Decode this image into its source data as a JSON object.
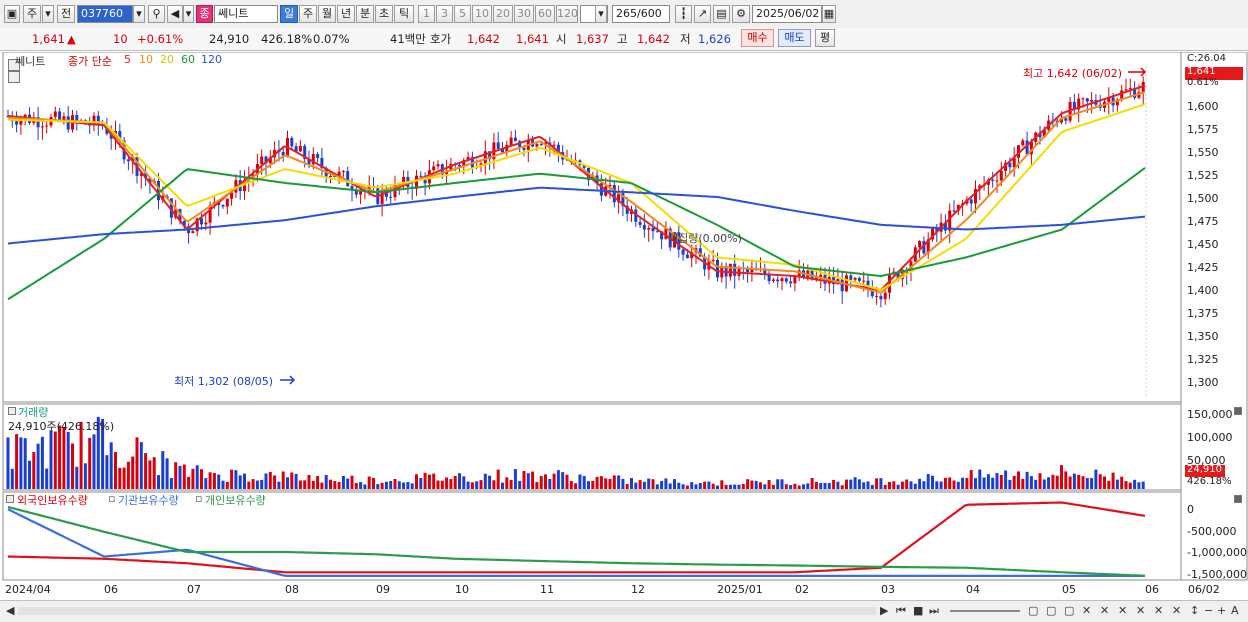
{
  "toolbar": {
    "mode_label": "주",
    "prev_label": "전",
    "code_value": "037760",
    "badge_label": "종",
    "stock_name": "쎄니트",
    "periods": [
      "일",
      "주",
      "월",
      "년",
      "분",
      "초",
      "틱"
    ],
    "active_period": "일",
    "intervals": [
      "1",
      "3",
      "5",
      "10",
      "20",
      "30",
      "60",
      "120"
    ],
    "count_value": "265",
    "count_total": "/600",
    "date_value": "2025/06/02"
  },
  "quote": {
    "price": "1,641",
    "change_arrow": "▲",
    "change": "10",
    "change_pct": "+0.61%",
    "volume": "24,910",
    "volume_ratio": "426.18%",
    "turnover": "0.07%",
    "amount": "41백만",
    "bid_ask_label": "호가",
    "ask": "1,642",
    "bid": "1,641",
    "open_label": "시",
    "open": "1,637",
    "high_label": "고",
    "high": "1,642",
    "low_label": "저",
    "low": "1,626",
    "buy_label": "매수",
    "sell_label": "매도",
    "eval_label": "평"
  },
  "price_panel": {
    "name": "쎄니트",
    "indicator_label": "종가 단순",
    "ma_periods": [
      "5",
      "10",
      "20",
      "60",
      "120"
    ],
    "y_ticks": [
      "1,600",
      "1,575",
      "1,550",
      "1,525",
      "1,500",
      "1,475",
      "1,450",
      "1,425",
      "1,400",
      "1,375",
      "1,350",
      "1,325",
      "1,300"
    ],
    "top_right": "C:26.04",
    "current_price_tag": "1,641",
    "current_pct_tag": "0.61%",
    "high_annotation": "최고 1,642 (06/02)",
    "low_annotation": "최저 1,302 (08/05)",
    "mid_annotation": "매집량(0.00%)"
  },
  "volume_panel": {
    "title": "거래량",
    "current_label": "24,910주(426.18%)",
    "y_ticks": [
      "150,000",
      "100,000",
      "50,000"
    ],
    "tag_value": "24,910",
    "tag_pct": "426.18%"
  },
  "holding_panel": {
    "legend": [
      "외국인보유수량",
      "기관보유수량",
      "개인보유수량"
    ],
    "y_ticks": [
      "0",
      "-500,000",
      "-1,000,000",
      "-1,500,000"
    ]
  },
  "x_axis": {
    "labels": [
      "2024/04",
      "06",
      "07",
      "08",
      "09",
      "10",
      "11",
      "12",
      "2025/01",
      "02",
      "03",
      "04",
      "05",
      "06"
    ],
    "right_date": "06/02"
  },
  "colors": {
    "up": "#d8000c",
    "down": "#1a3fd0",
    "ma5": "#e0202a",
    "ma10": "#f08a1c",
    "ma20": "#f5dc00",
    "ma60": "#1a9a3c",
    "ma120": "#2a50d8",
    "foreign": "#e0101a",
    "institution": "#3a6ee0",
    "individual": "#2e9a50"
  },
  "chart_data": [
    {
      "type": "line",
      "title": "",
      "x": [
        "2024/04",
        "06",
        "07",
        "08",
        "09",
        "10",
        "11",
        "12",
        "2025/01",
        "02",
        "03",
        "04",
        "05",
        "06"
      ],
      "series": [
        {
          "name": "5",
          "values": [
            1592,
            1582,
            1470,
            1560,
            1505,
            1540,
            1570,
            1490,
            1425,
            1420,
            1405,
            1500,
            1595,
            1625
          ]
        },
        {
          "name": "10",
          "values": [
            1590,
            1585,
            1478,
            1550,
            1510,
            1535,
            1565,
            1500,
            1430,
            1425,
            1402,
            1480,
            1590,
            1618
          ]
        },
        {
          "name": "20",
          "values": [
            1588,
            1585,
            1495,
            1535,
            1515,
            1530,
            1558,
            1520,
            1440,
            1432,
            1405,
            1460,
            1575,
            1605
          ]
        },
        {
          "name": "60",
          "values": [
            1395,
            1460,
            1535,
            1520,
            1510,
            1520,
            1530,
            1520,
            1475,
            1430,
            1420,
            1440,
            1470,
            1537
          ]
        },
        {
          "name": "120",
          "values": [
            1455,
            1465,
            1470,
            1480,
            1495,
            1505,
            1515,
            1510,
            1505,
            1490,
            1475,
            1470,
            1475,
            1484
          ]
        }
      ],
      "ylim": [
        1290,
        1650
      ],
      "high": {
        "value": 1642,
        "date": "06/02"
      },
      "low": {
        "value": 1302,
        "date": "08/05"
      }
    },
    {
      "type": "bar",
      "title": "거래량",
      "x": [
        "2024/04",
        "06",
        "07",
        "08",
        "09",
        "10",
        "11",
        "12",
        "2025/01",
        "02",
        "03",
        "04",
        "05",
        "06"
      ],
      "series": [
        {
          "name": "거래량",
          "values": [
            90000,
            120000,
            40000,
            30000,
            22000,
            30000,
            35000,
            20000,
            15000,
            18000,
            20000,
            30000,
            40000,
            24910
          ]
        }
      ],
      "ylim": [
        0,
        160000
      ]
    },
    {
      "type": "line",
      "title": "",
      "x": [
        "2024/04",
        "06",
        "07",
        "08",
        "09",
        "10",
        "11",
        "12",
        "2025/01",
        "02",
        "03",
        "04",
        "05",
        "06"
      ],
      "series": [
        {
          "name": "외국인보유수량",
          "values": [
            -1150000,
            -1200000,
            -1300000,
            -1500000,
            -1500000,
            -1500000,
            -1500000,
            -1500000,
            -1500000,
            -1500000,
            -1400000,
            0,
            50000,
            -250000
          ]
        },
        {
          "name": "기관보유수량",
          "values": [
            -100000,
            -1150000,
            -1000000,
            -1580000,
            -1580000,
            -1580000,
            -1580000,
            -1580000,
            -1580000,
            -1580000,
            -1580000,
            -1580000,
            -1580000,
            -1580000
          ]
        },
        {
          "name": "개인보유수량",
          "values": [
            -50000,
            -600000,
            -1050000,
            -1050000,
            -1100000,
            -1200000,
            -1250000,
            -1300000,
            -1330000,
            -1350000,
            -1380000,
            -1400000,
            -1500000,
            -1580000
          ]
        }
      ],
      "ylim": [
        -1650000,
        150000
      ]
    }
  ]
}
